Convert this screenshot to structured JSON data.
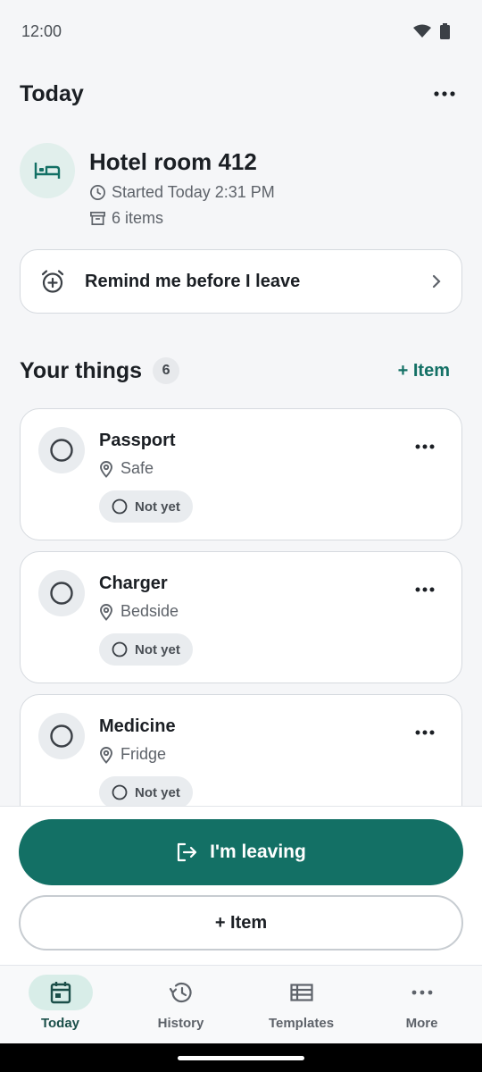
{
  "status_bar": {
    "time": "12:00"
  },
  "header": {
    "title": "Today"
  },
  "session": {
    "title": "Hotel room 412",
    "started": "Started Today 2:31 PM",
    "items_count": "6 items"
  },
  "reminder": {
    "label": "Remind me before I leave"
  },
  "things": {
    "title": "Your things",
    "count": "6",
    "add_label": "+ Item",
    "items": [
      {
        "name": "Passport",
        "location": "Safe",
        "status": "Not yet"
      },
      {
        "name": "Charger",
        "location": "Bedside",
        "status": "Not yet"
      },
      {
        "name": "Medicine",
        "location": "Fridge",
        "status": "Not yet"
      }
    ]
  },
  "actions": {
    "leaving_label": "I'm leaving",
    "add_item_label": "+ Item"
  },
  "nav": {
    "items": [
      {
        "label": "Today",
        "icon": "calendar-icon",
        "active": true
      },
      {
        "label": "History",
        "icon": "history-icon",
        "active": false
      },
      {
        "label": "Templates",
        "icon": "list-icon",
        "active": false
      },
      {
        "label": "More",
        "icon": "more-icon",
        "active": false
      }
    ]
  },
  "colors": {
    "accent": "#137065",
    "accent_soft": "#e1efec"
  }
}
